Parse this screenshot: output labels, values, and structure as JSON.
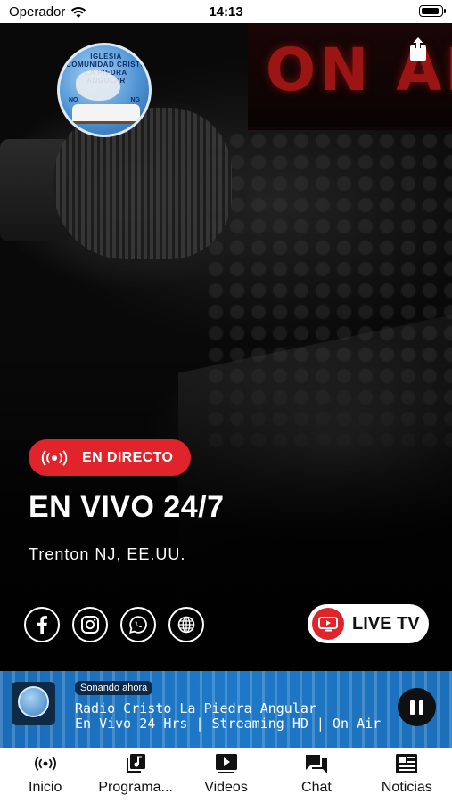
{
  "status_bar": {
    "carrier": "Operador",
    "time": "14:13",
    "battery_level": 0.9
  },
  "hero": {
    "background_sign_text": "ON AIR",
    "logo": {
      "ring_text": "IGLESIA COMUNIDAD CRISTO LA PIEDRA ANGULAR",
      "initials_left": "NO",
      "initials_right": "NG"
    },
    "live_badge_label": "EN DIRECTO",
    "title": "EN VIVO 24/7",
    "subtitle": "Trenton NJ, EE.UU.",
    "social_icons": [
      "facebook-icon",
      "instagram-icon",
      "whatsapp-icon",
      "globe-icon"
    ],
    "live_tv_label": "LIVE TV",
    "accent_color": "#e1232b"
  },
  "now_playing": {
    "badge": "Sonando ahora",
    "line1": "Radio Cristo La Piedra Angular",
    "line2": "En Vivo 24 Hrs | Streaming HD | On Air",
    "bar_color": "#1d79c8"
  },
  "tabs": [
    {
      "label": "Inicio",
      "icon": "broadcast-icon"
    },
    {
      "label": "Programa...",
      "icon": "music-note-icon"
    },
    {
      "label": "Videos",
      "icon": "play-icon"
    },
    {
      "label": "Chat",
      "icon": "chat-icon"
    },
    {
      "label": "Noticias",
      "icon": "newspaper-icon"
    }
  ]
}
